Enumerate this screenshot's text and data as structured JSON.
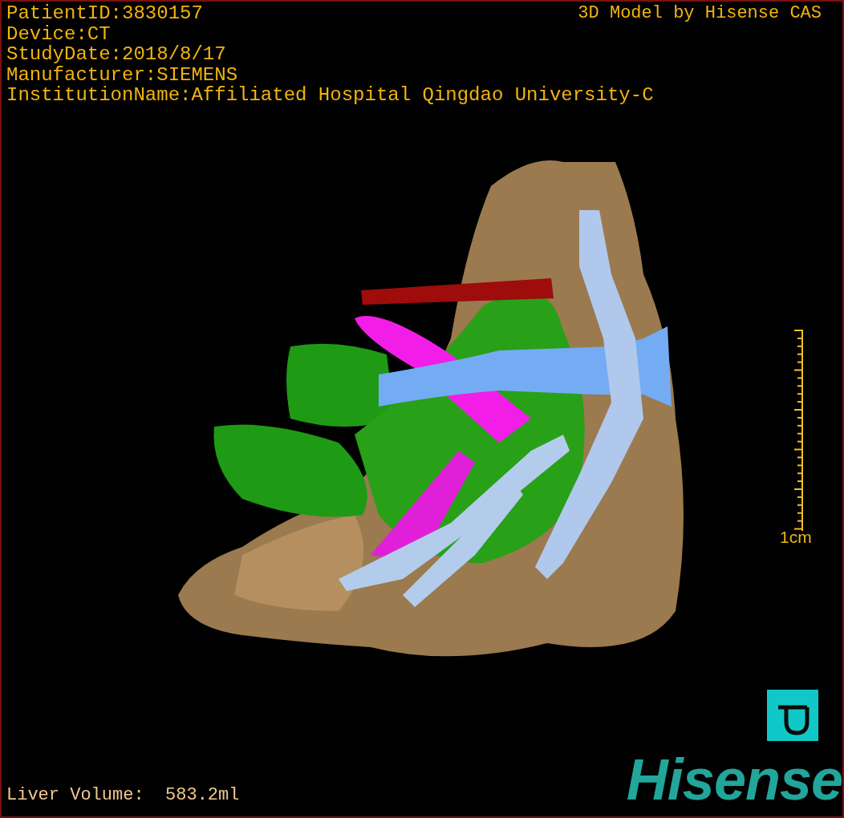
{
  "info_lines": [
    "PatientID:3830157",
    "Device:CT",
    "StudyDate:2018/8/17",
    "Manufacturer:SIEMENS",
    "InstitutionName:Affiliated Hospital Qingdao University-C"
  ],
  "model_title": "3D Model by Hisense CAS",
  "scale": {
    "label": "1cm"
  },
  "liver_volume": "Liver Volume:  583.2ml",
  "logo": "Hisense"
}
